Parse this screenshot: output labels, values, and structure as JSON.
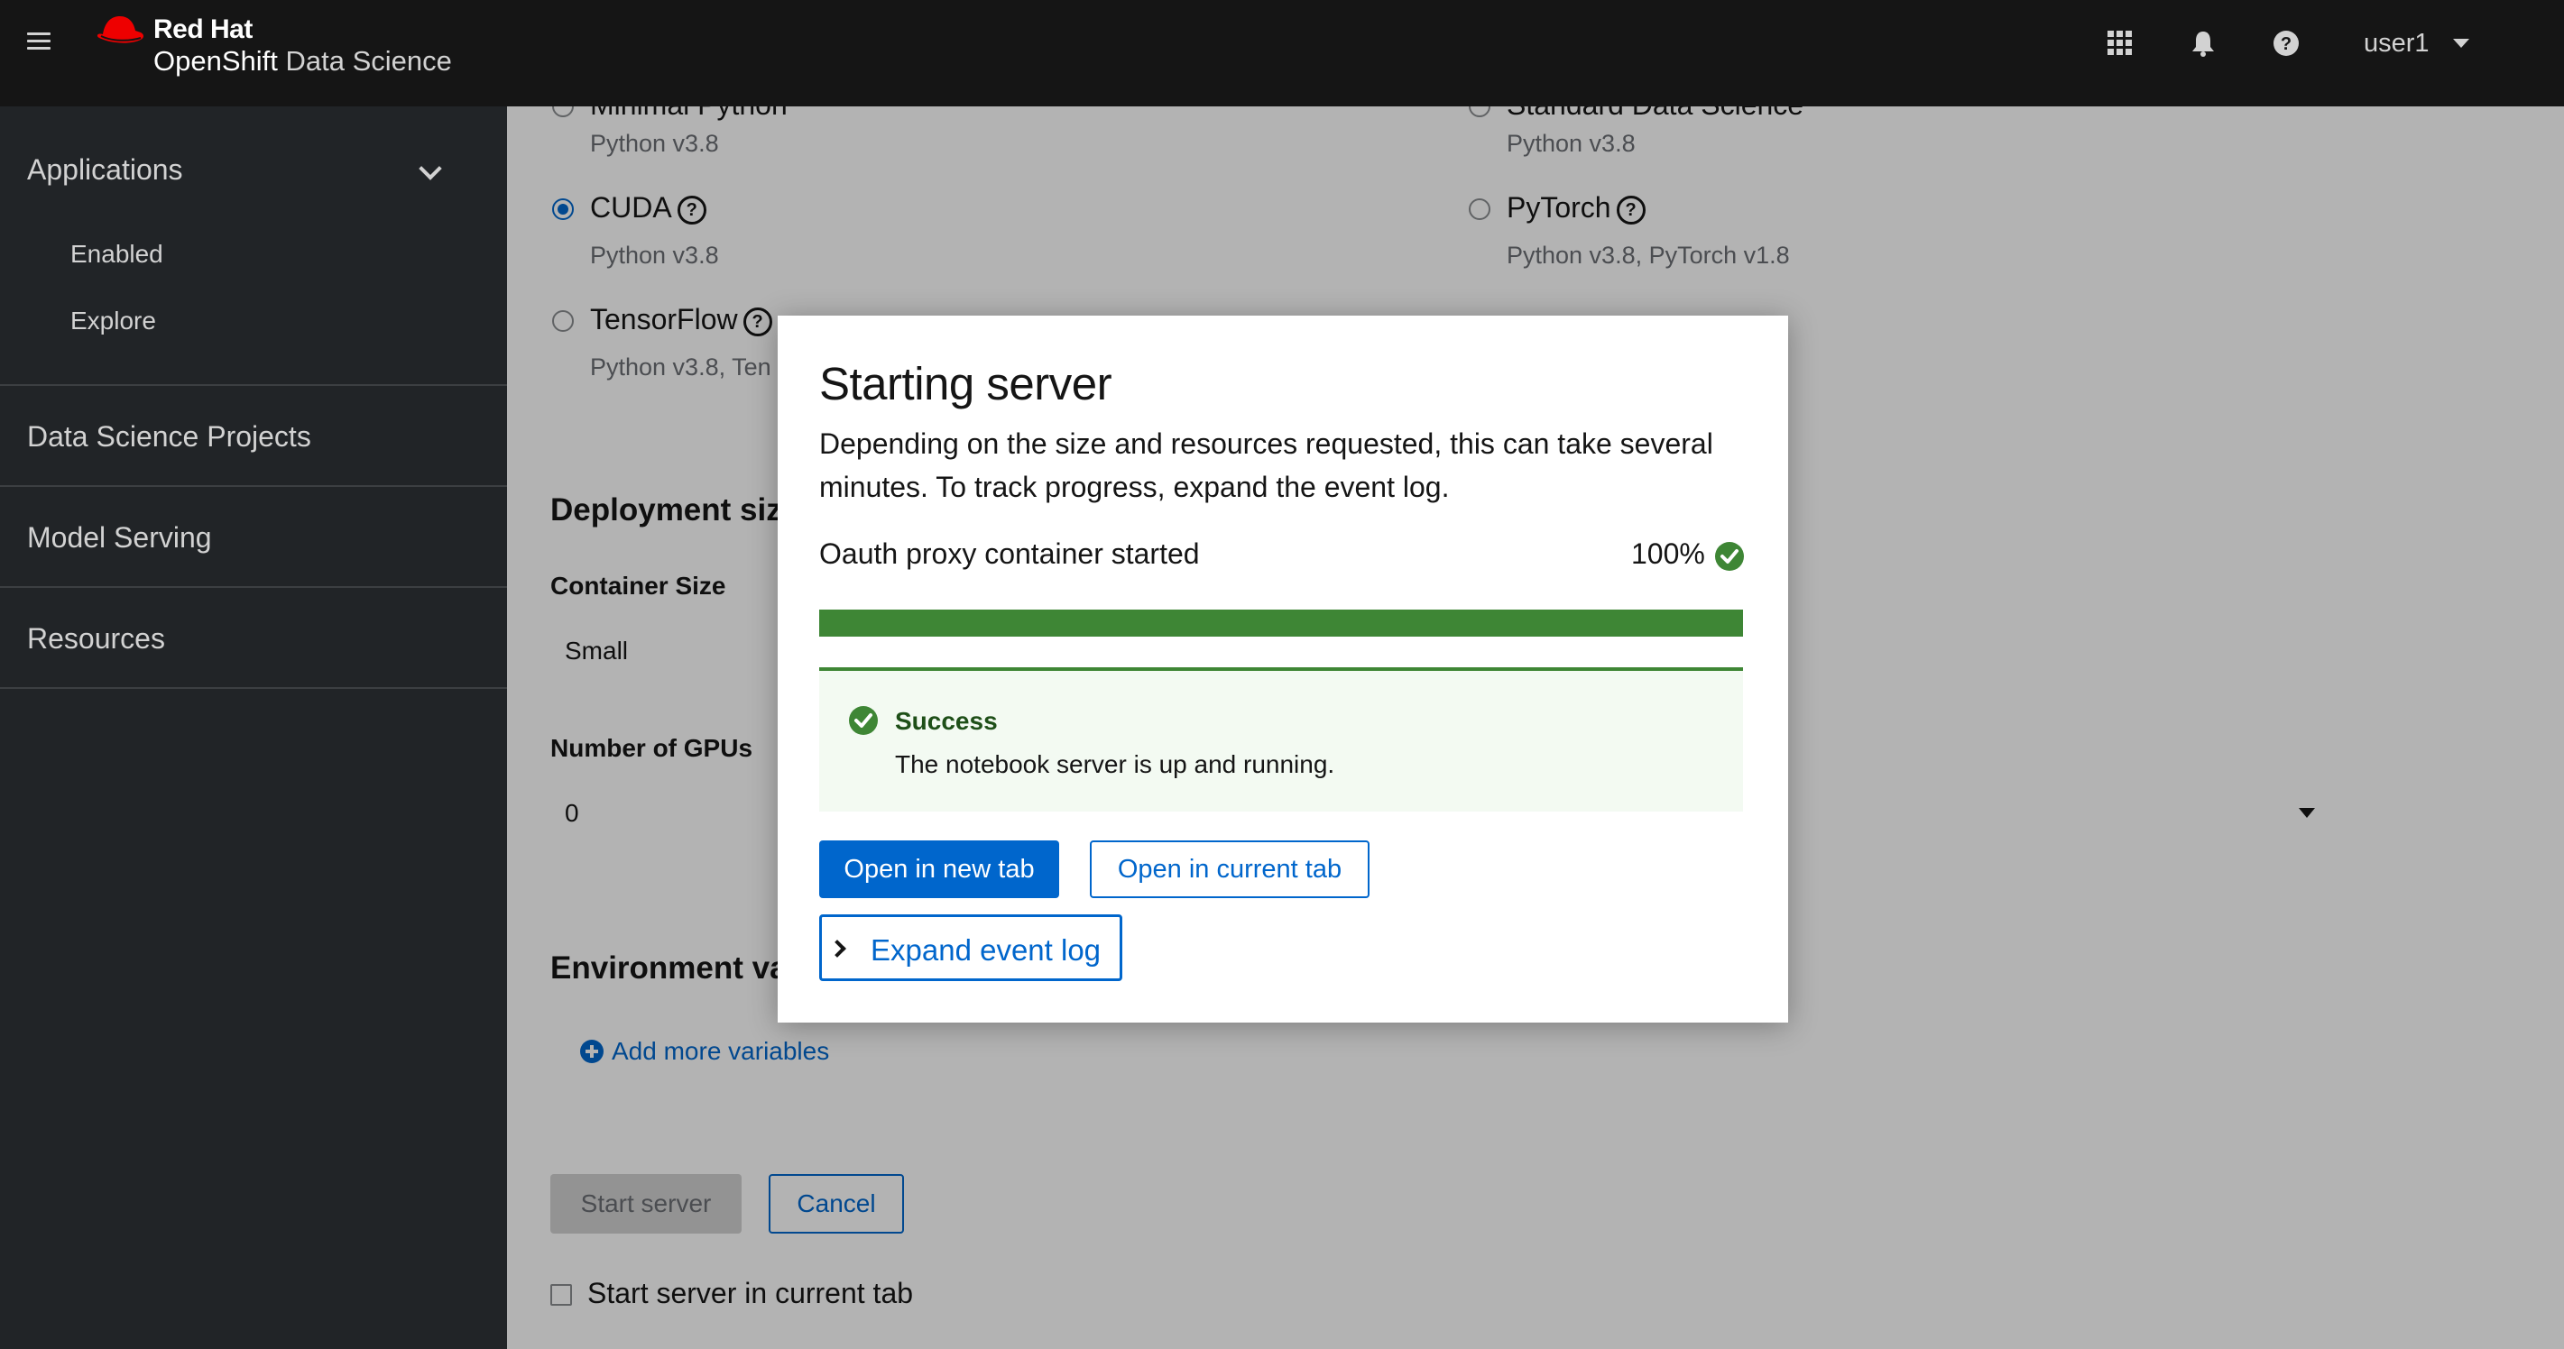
{
  "colors": {
    "masthead_bg": "#151515",
    "sidebar_bg": "#212427",
    "primary": "#0066cc",
    "success": "#3e8635"
  },
  "masthead": {
    "brand_line1": "Red Hat",
    "brand_line2a": "OpenShift",
    "brand_line2b": "Data Science",
    "icons": [
      "hamburger-icon",
      "app-launcher-icon",
      "bell-icon",
      "help-icon"
    ],
    "user": "user1"
  },
  "sidebar": {
    "applications": "Applications",
    "enabled": "Enabled",
    "explore": "Explore",
    "projects": "Data Science Projects",
    "model_serving": "Model Serving",
    "resources": "Resources"
  },
  "form": {
    "images": [
      {
        "label": "Minimal Python",
        "sub": "Python v3.8",
        "selected": false
      },
      {
        "label": "Standard Data Science",
        "sub": "Python v3.8",
        "selected": false
      },
      {
        "label": "CUDA",
        "sub": "Python v3.8",
        "selected": true
      },
      {
        "label": "PyTorch",
        "sub": "Python v3.8, PyTorch v1.8",
        "selected": false
      },
      {
        "label": "TensorFlow",
        "sub": "Python v3.8, Ten",
        "selected": false
      }
    ],
    "deployment_title": "Deployment siz",
    "container_size_label": "Container Size",
    "container_size_value": "Small",
    "gpus_label": "Number of GPUs",
    "gpus_value": "0",
    "env_title": "Environment va",
    "add_vars": "Add more variables",
    "start_button": "Start server",
    "cancel_button": "Cancel",
    "current_tab_checkbox": "Start server in current tab"
  },
  "modal": {
    "title": "Starting server",
    "description": "Depending on the size and resources requested, this can take several minutes. To track progress, expand the event log.",
    "progress_label": "Oauth proxy container started",
    "progress_value": "100%",
    "progress_fraction": 1.0,
    "alert_title": "Success",
    "alert_body": "The notebook server is up and running.",
    "open_new_tab": "Open in new tab",
    "open_current_tab": "Open in current tab",
    "expand_log": "Expand event log"
  }
}
